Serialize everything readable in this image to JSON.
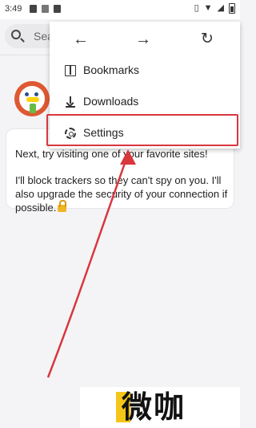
{
  "status_bar": {
    "time": "3:49",
    "left_icons": [
      "notification-icon",
      "sim-icon",
      "notification-icon"
    ],
    "right_icons": [
      "vibrate-icon",
      "wifi-icon",
      "signal-icon",
      "battery-icon"
    ]
  },
  "search": {
    "placeholder": "Sea"
  },
  "chat": {
    "avatar_icon": "duck-avatar-icon",
    "line1": "Next, try visiting one of your favorite sites!",
    "line2": "I'll block trackers so they can't spy on you. I'll also upgrade the security of your connection if possible.",
    "lock_icon": "lock-icon"
  },
  "menu": {
    "nav": {
      "back_icon": "arrow-left-icon",
      "forward_icon": "arrow-right-icon",
      "refresh_icon": "refresh-icon"
    },
    "items": [
      {
        "label": "Bookmarks",
        "icon": "book-icon"
      },
      {
        "label": "Downloads",
        "icon": "download-icon"
      },
      {
        "label": "Settings",
        "icon": "gear-icon"
      }
    ]
  },
  "annotation": {
    "highlight_color": "#d9363e",
    "arrow_color": "#d9363e"
  },
  "watermark": {
    "text": "微咖",
    "accent_color": "#f5c518"
  }
}
